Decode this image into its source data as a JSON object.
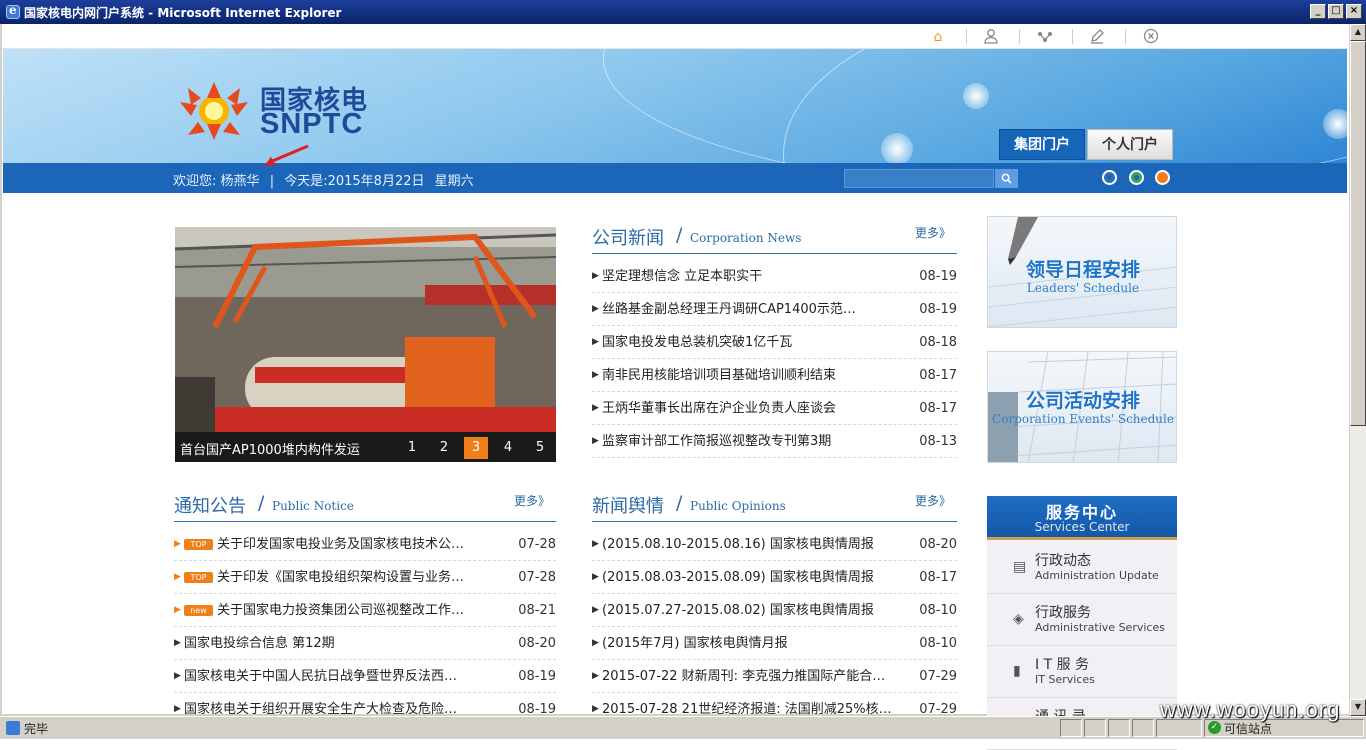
{
  "window": {
    "title": "国家核电内网门户系统 - Microsoft Internet Explorer",
    "buttons": [
      "_",
      "□",
      "×"
    ]
  },
  "toolbar": {
    "icons": [
      "home-icon",
      "user-icon",
      "share-icon",
      "edit-icon",
      "close-circle-icon"
    ]
  },
  "header": {
    "logo_cn": "国家核电",
    "logo_en": "SNPTC",
    "tabs": [
      {
        "label": "集团门户",
        "active": true
      },
      {
        "label": "个人门户",
        "active": false
      }
    ],
    "welcome_label": "欢迎您:",
    "user": "杨燕华",
    "divider": "|",
    "date_text": "今天是:2015年8月22日",
    "weekday": "星期六",
    "theme_dots": [
      "#2d6fb2",
      "#3aa55a",
      "#f07f1a"
    ]
  },
  "slideshow": {
    "caption": "首台国产AP1000堆内构件发运",
    "pages": [
      "1",
      "2",
      "3",
      "4",
      "5"
    ],
    "active_page": 3
  },
  "corp_news": {
    "title_cn": "公司新闻",
    "slash": "/",
    "title_en": "Corporation News",
    "more": "更多》",
    "items": [
      {
        "title": "坚定理想信念 立足本职实干",
        "date": "08-19"
      },
      {
        "title": "丝路基金副总经理王丹调研CAP1400示范…",
        "date": "08-19"
      },
      {
        "title": "国家电投发电总装机突破1亿千瓦",
        "date": "08-18"
      },
      {
        "title": "南非民用核能培训项目基础培训顺利结束",
        "date": "08-17"
      },
      {
        "title": "王炳华董事长出席在沪企业负责人座谈会",
        "date": "08-17"
      },
      {
        "title": "监察审计部工作简报巡视整改专刊第3期",
        "date": "08-13"
      }
    ]
  },
  "notice": {
    "title_cn": "通知公告",
    "slash": "/",
    "title_en": "Public Notice",
    "more": "更多》",
    "items": [
      {
        "tag": "TOP",
        "title": "关于印发国家电投业务及国家核电技术公…",
        "date": "07-28"
      },
      {
        "tag": "TOP",
        "title": "关于印发《国家电投组织架构设置与业务…",
        "date": "07-28"
      },
      {
        "tag": "new",
        "title": "关于国家电力投资集团公司巡视整改工作…",
        "date": "08-21"
      },
      {
        "tag": "",
        "title": "国家电投综合信息 第12期",
        "date": "08-20"
      },
      {
        "tag": "",
        "title": "国家核电关于中国人民抗日战争暨世界反法西…",
        "date": "08-19"
      },
      {
        "tag": "",
        "title": "国家核电关于组织开展安全生产大检查及危险…",
        "date": "08-19"
      }
    ]
  },
  "opinions": {
    "title_cn": "新闻舆情",
    "slash": "/",
    "title_en": "Public Opinions",
    "more": "更多》",
    "items": [
      {
        "title": "(2015.08.10-2015.08.16) 国家核电舆情周报",
        "date": "08-20"
      },
      {
        "title": "(2015.08.03-2015.08.09) 国家核电舆情周报",
        "date": "08-17"
      },
      {
        "title": "(2015.07.27-2015.08.02) 国家核电舆情周报",
        "date": "08-10"
      },
      {
        "title": "(2015年7月) 国家核电舆情月报",
        "date": "08-10"
      },
      {
        "title": "2015-07-22 财新周刊: 李克强力推国际产能合…",
        "date": "07-29"
      },
      {
        "title": "2015-07-28 21世纪经济报道: 法国削减25%核…",
        "date": "07-29"
      }
    ]
  },
  "cards": [
    {
      "cn": "领导日程安排",
      "en": "Leaders' Schedule"
    },
    {
      "cn": "公司活动安排",
      "en": "Corporation Events' Schedule"
    }
  ],
  "services": {
    "title_cn": "服务中心",
    "title_en": "Services Center",
    "items": [
      {
        "icon": "admin-update-icon",
        "cn": "行政动态",
        "en": "Administration Update"
      },
      {
        "icon": "admin-services-icon",
        "cn": "行政服务",
        "en": "Administrative Services"
      },
      {
        "icon": "it-services-icon",
        "cn": "I T 服 务",
        "en": "IT Services"
      },
      {
        "icon": "phonebook-icon",
        "cn": "通 讯 录",
        "en": ""
      }
    ]
  },
  "statusbar": {
    "text": "完毕",
    "zone": "可信站点"
  },
  "watermark": "www.wooyun.org"
}
